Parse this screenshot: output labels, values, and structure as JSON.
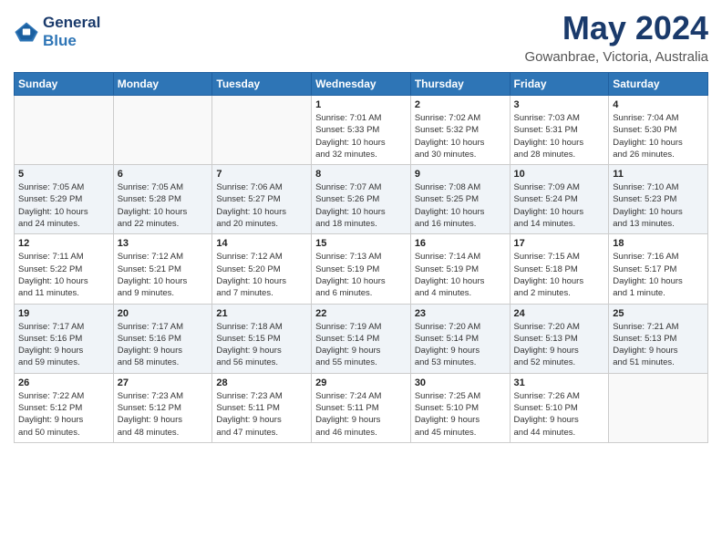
{
  "header": {
    "logo_line1": "General",
    "logo_line2": "Blue",
    "title": "May 2024",
    "subtitle": "Gowanbrae, Victoria, Australia"
  },
  "days_of_week": [
    "Sunday",
    "Monday",
    "Tuesday",
    "Wednesday",
    "Thursday",
    "Friday",
    "Saturday"
  ],
  "weeks": [
    [
      {
        "day": "",
        "info": ""
      },
      {
        "day": "",
        "info": ""
      },
      {
        "day": "",
        "info": ""
      },
      {
        "day": "1",
        "info": "Sunrise: 7:01 AM\nSunset: 5:33 PM\nDaylight: 10 hours\nand 32 minutes."
      },
      {
        "day": "2",
        "info": "Sunrise: 7:02 AM\nSunset: 5:32 PM\nDaylight: 10 hours\nand 30 minutes."
      },
      {
        "day": "3",
        "info": "Sunrise: 7:03 AM\nSunset: 5:31 PM\nDaylight: 10 hours\nand 28 minutes."
      },
      {
        "day": "4",
        "info": "Sunrise: 7:04 AM\nSunset: 5:30 PM\nDaylight: 10 hours\nand 26 minutes."
      }
    ],
    [
      {
        "day": "5",
        "info": "Sunrise: 7:05 AM\nSunset: 5:29 PM\nDaylight: 10 hours\nand 24 minutes."
      },
      {
        "day": "6",
        "info": "Sunrise: 7:05 AM\nSunset: 5:28 PM\nDaylight: 10 hours\nand 22 minutes."
      },
      {
        "day": "7",
        "info": "Sunrise: 7:06 AM\nSunset: 5:27 PM\nDaylight: 10 hours\nand 20 minutes."
      },
      {
        "day": "8",
        "info": "Sunrise: 7:07 AM\nSunset: 5:26 PM\nDaylight: 10 hours\nand 18 minutes."
      },
      {
        "day": "9",
        "info": "Sunrise: 7:08 AM\nSunset: 5:25 PM\nDaylight: 10 hours\nand 16 minutes."
      },
      {
        "day": "10",
        "info": "Sunrise: 7:09 AM\nSunset: 5:24 PM\nDaylight: 10 hours\nand 14 minutes."
      },
      {
        "day": "11",
        "info": "Sunrise: 7:10 AM\nSunset: 5:23 PM\nDaylight: 10 hours\nand 13 minutes."
      }
    ],
    [
      {
        "day": "12",
        "info": "Sunrise: 7:11 AM\nSunset: 5:22 PM\nDaylight: 10 hours\nand 11 minutes."
      },
      {
        "day": "13",
        "info": "Sunrise: 7:12 AM\nSunset: 5:21 PM\nDaylight: 10 hours\nand 9 minutes."
      },
      {
        "day": "14",
        "info": "Sunrise: 7:12 AM\nSunset: 5:20 PM\nDaylight: 10 hours\nand 7 minutes."
      },
      {
        "day": "15",
        "info": "Sunrise: 7:13 AM\nSunset: 5:19 PM\nDaylight: 10 hours\nand 6 minutes."
      },
      {
        "day": "16",
        "info": "Sunrise: 7:14 AM\nSunset: 5:19 PM\nDaylight: 10 hours\nand 4 minutes."
      },
      {
        "day": "17",
        "info": "Sunrise: 7:15 AM\nSunset: 5:18 PM\nDaylight: 10 hours\nand 2 minutes."
      },
      {
        "day": "18",
        "info": "Sunrise: 7:16 AM\nSunset: 5:17 PM\nDaylight: 10 hours\nand 1 minute."
      }
    ],
    [
      {
        "day": "19",
        "info": "Sunrise: 7:17 AM\nSunset: 5:16 PM\nDaylight: 9 hours\nand 59 minutes."
      },
      {
        "day": "20",
        "info": "Sunrise: 7:17 AM\nSunset: 5:16 PM\nDaylight: 9 hours\nand 58 minutes."
      },
      {
        "day": "21",
        "info": "Sunrise: 7:18 AM\nSunset: 5:15 PM\nDaylight: 9 hours\nand 56 minutes."
      },
      {
        "day": "22",
        "info": "Sunrise: 7:19 AM\nSunset: 5:14 PM\nDaylight: 9 hours\nand 55 minutes."
      },
      {
        "day": "23",
        "info": "Sunrise: 7:20 AM\nSunset: 5:14 PM\nDaylight: 9 hours\nand 53 minutes."
      },
      {
        "day": "24",
        "info": "Sunrise: 7:20 AM\nSunset: 5:13 PM\nDaylight: 9 hours\nand 52 minutes."
      },
      {
        "day": "25",
        "info": "Sunrise: 7:21 AM\nSunset: 5:13 PM\nDaylight: 9 hours\nand 51 minutes."
      }
    ],
    [
      {
        "day": "26",
        "info": "Sunrise: 7:22 AM\nSunset: 5:12 PM\nDaylight: 9 hours\nand 50 minutes."
      },
      {
        "day": "27",
        "info": "Sunrise: 7:23 AM\nSunset: 5:12 PM\nDaylight: 9 hours\nand 48 minutes."
      },
      {
        "day": "28",
        "info": "Sunrise: 7:23 AM\nSunset: 5:11 PM\nDaylight: 9 hours\nand 47 minutes."
      },
      {
        "day": "29",
        "info": "Sunrise: 7:24 AM\nSunset: 5:11 PM\nDaylight: 9 hours\nand 46 minutes."
      },
      {
        "day": "30",
        "info": "Sunrise: 7:25 AM\nSunset: 5:10 PM\nDaylight: 9 hours\nand 45 minutes."
      },
      {
        "day": "31",
        "info": "Sunrise: 7:26 AM\nSunset: 5:10 PM\nDaylight: 9 hours\nand 44 minutes."
      },
      {
        "day": "",
        "info": ""
      }
    ]
  ],
  "accent_color": "#2e75b6",
  "logo_color": "#1a3a6b"
}
